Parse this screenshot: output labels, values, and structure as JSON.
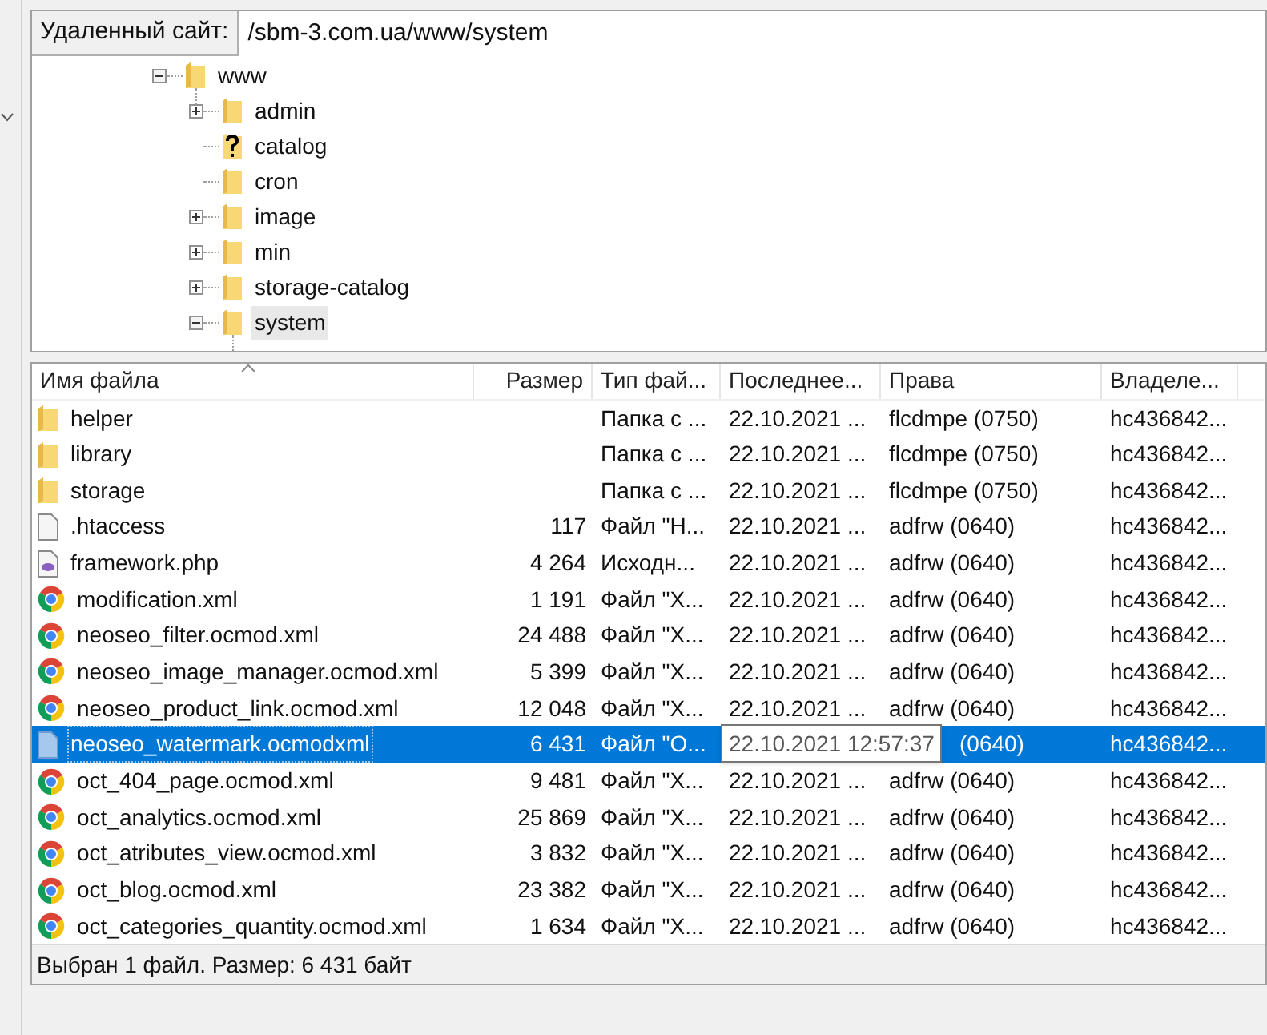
{
  "address_bar": {
    "label": "Удаленный сайт:",
    "value": "/sbm-3.com.ua/www/system"
  },
  "tree": [
    {
      "name": "www",
      "kind": "folder",
      "expandable": true,
      "expanded": true,
      "selected": false,
      "children": [
        {
          "name": "admin",
          "kind": "folder",
          "expandable": true,
          "expanded": false,
          "selected": false
        },
        {
          "name": "catalog",
          "kind": "unknown",
          "expandable": false,
          "selected": false
        },
        {
          "name": "cron",
          "kind": "folder",
          "expandable": false,
          "selected": false
        },
        {
          "name": "image",
          "kind": "folder",
          "expandable": true,
          "expanded": false,
          "selected": false
        },
        {
          "name": "min",
          "kind": "folder",
          "expandable": true,
          "expanded": false,
          "selected": false
        },
        {
          "name": "storage-catalog",
          "kind": "folder",
          "expandable": true,
          "expanded": false,
          "selected": false
        },
        {
          "name": "system",
          "kind": "folder",
          "expandable": true,
          "expanded": true,
          "selected": true
        }
      ]
    }
  ],
  "table": {
    "columns": [
      "Имя файла",
      "Размер",
      "Тип фай...",
      "Последнее...",
      "Права",
      "Владеле..."
    ],
    "rows": [
      {
        "kind": "folder",
        "selected": false,
        "name": "helper",
        "size": "",
        "type": "Папка с ...",
        "date": "22.10.2021 ...",
        "rights": "flcdmpe (0750)",
        "owner": "hc436842..."
      },
      {
        "kind": "folder",
        "selected": false,
        "name": "library",
        "size": "",
        "type": "Папка с ...",
        "date": "22.10.2021 ...",
        "rights": "flcdmpe (0750)",
        "owner": "hc436842..."
      },
      {
        "kind": "folder",
        "selected": false,
        "name": "storage",
        "size": "",
        "type": "Папка с ...",
        "date": "22.10.2021 ...",
        "rights": "flcdmpe (0750)",
        "owner": "hc436842..."
      },
      {
        "kind": "file",
        "selected": false,
        "name": ".htaccess",
        "size": "117",
        "type": "Файл \"Н...",
        "date": "22.10.2021 ...",
        "rights": "adfrw (0640)",
        "owner": "hc436842..."
      },
      {
        "kind": "php",
        "selected": false,
        "name": "framework.php",
        "size": "4 264",
        "type": "Исходн...",
        "date": "22.10.2021 ...",
        "rights": "adfrw (0640)",
        "owner": "hc436842..."
      },
      {
        "kind": "xml",
        "selected": false,
        "name": "modification.xml",
        "size": "1 191",
        "type": "Файл \"X...",
        "date": "22.10.2021 ...",
        "rights": "adfrw (0640)",
        "owner": "hc436842..."
      },
      {
        "kind": "xml",
        "selected": false,
        "name": "neoseo_filter.ocmod.xml",
        "size": "24 488",
        "type": "Файл \"X...",
        "date": "22.10.2021 ...",
        "rights": "adfrw (0640)",
        "owner": "hc436842..."
      },
      {
        "kind": "xml",
        "selected": false,
        "name": "neoseo_image_manager.ocmod.xml",
        "size": "5 399",
        "type": "Файл \"X...",
        "date": "22.10.2021 ...",
        "rights": "adfrw (0640)",
        "owner": "hc436842..."
      },
      {
        "kind": "xml",
        "selected": false,
        "name": "neoseo_product_link.ocmod.xml",
        "size": "12 048",
        "type": "Файл \"X...",
        "date": "22.10.2021 ...",
        "rights": "adfrw (0640)",
        "owner": "hc436842..."
      },
      {
        "kind": "plain",
        "selected": true,
        "name": "neoseo_watermark.ocmodxml",
        "size": "6 431",
        "type": "Файл \"О...",
        "tooltip": "22.10.2021 12:57:37",
        "rights": "(0640)",
        "owner": "hc436842..."
      },
      {
        "kind": "xml",
        "selected": false,
        "name": "oct_404_page.ocmod.xml",
        "size": "9 481",
        "type": "Файл \"X...",
        "date": "22.10.2021 ...",
        "rights": "adfrw (0640)",
        "owner": "hc436842..."
      },
      {
        "kind": "xml",
        "selected": false,
        "name": "oct_analytics.ocmod.xml",
        "size": "25 869",
        "type": "Файл \"X...",
        "date": "22.10.2021 ...",
        "rights": "adfrw (0640)",
        "owner": "hc436842..."
      },
      {
        "kind": "xml",
        "selected": false,
        "name": "oct_atributes_view.ocmod.xml",
        "size": "3 832",
        "type": "Файл \"X...",
        "date": "22.10.2021 ...",
        "rights": "adfrw (0640)",
        "owner": "hc436842..."
      },
      {
        "kind": "xml",
        "selected": false,
        "name": "oct_blog.ocmod.xml",
        "size": "23 382",
        "type": "Файл \"X...",
        "date": "22.10.2021 ...",
        "rights": "adfrw (0640)",
        "owner": "hc436842..."
      },
      {
        "kind": "xml",
        "selected": false,
        "name": "oct_categories_quantity.ocmod.xml",
        "size": "1 634",
        "type": "Файл \"X...",
        "date": "22.10.2021 ...",
        "rights": "adfrw (0640)",
        "owner": "hc436842..."
      }
    ]
  },
  "status_bar": "Выбран 1 файл. Размер: 6 431 байт"
}
